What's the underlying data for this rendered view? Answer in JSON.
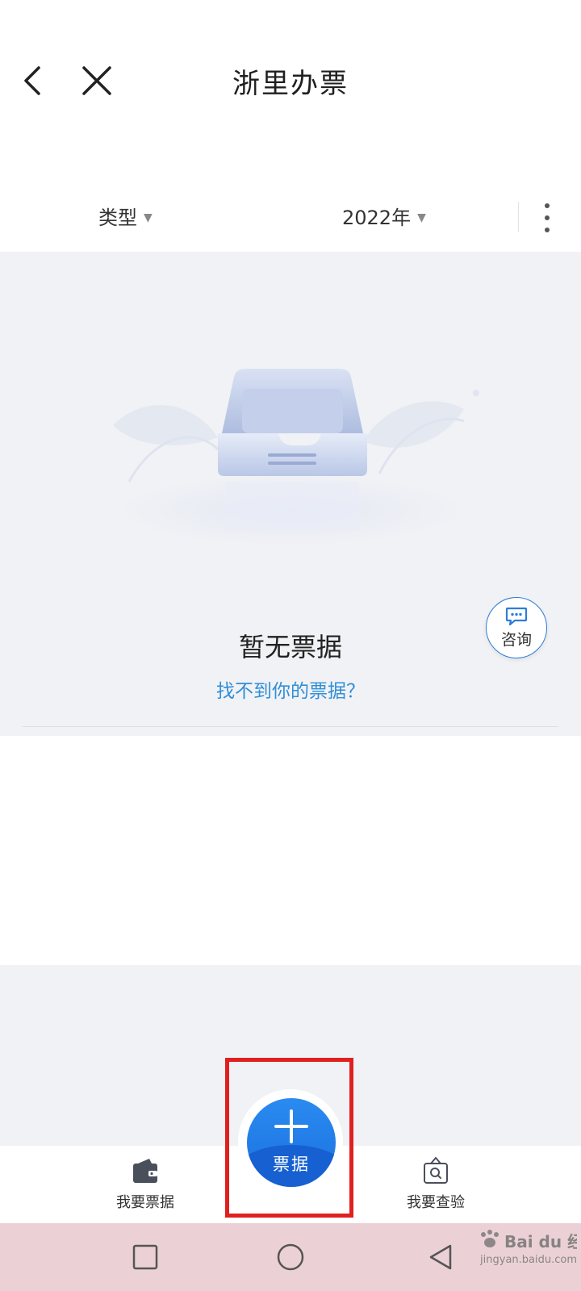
{
  "header": {
    "title": "浙里办票",
    "back_icon": "chevron-left-icon",
    "close_icon": "close-icon"
  },
  "filters": {
    "type_label": "类型",
    "year_label": "2022年",
    "caret": "▼",
    "more_icon": "more-vertical-icon"
  },
  "empty_state": {
    "title": "暂无票据",
    "link": "找不到你的票据？",
    "illustration_icon": "empty-inbox-illustration"
  },
  "consult": {
    "label": "咨询",
    "icon": "chat-bubble-icon"
  },
  "tabs": {
    "left_label": "我要票据",
    "left_icon": "wallet-icon",
    "right_label": "我要查验",
    "right_icon": "inspect-icon",
    "fab_label": "票据",
    "fab_icon": "plus-icon"
  },
  "system_nav": {
    "recents_icon": "square-icon",
    "home_icon": "circle-icon",
    "back_icon": "triangle-back-icon"
  },
  "watermark": {
    "text": "jingyan.baidu.com"
  },
  "colors": {
    "accent": "#2f8fd8",
    "fab": "#1b6fe0",
    "highlight": "#e0201e",
    "system_nav_bg": "#ebd1d6",
    "empty_bg": "#f1f2f5"
  }
}
